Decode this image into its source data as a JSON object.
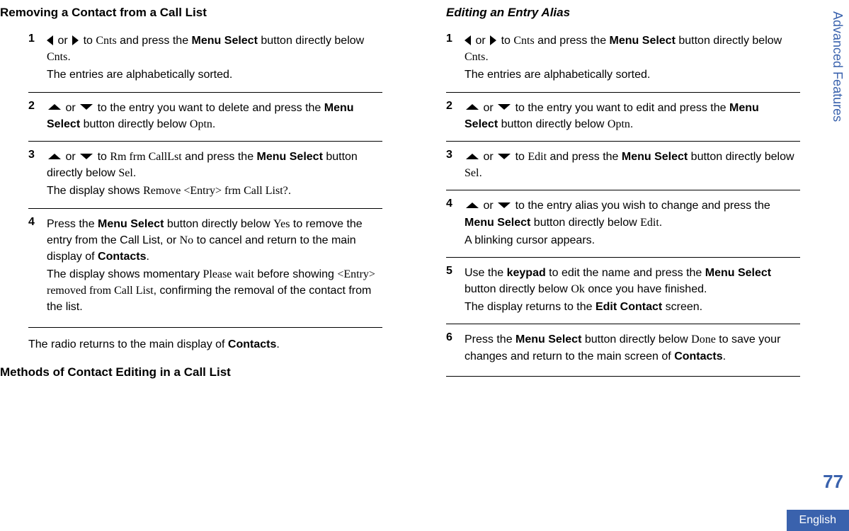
{
  "sidebar": {
    "section": "Advanced Features"
  },
  "page_number": "77",
  "language": "English",
  "left": {
    "heading": "Removing a Contact from a Call List",
    "steps": [
      {
        "num": "1",
        "pre_or": "",
        "post_or": " to ",
        "mono1": "Cnts",
        "mid1": " and press the ",
        "bold1": "Menu Select",
        "mid2": " button directly below ",
        "mono2": "Cnts",
        "tail1": ".",
        "line2": "The entries are alphabetically sorted."
      },
      {
        "num": "2",
        "pre_or": "",
        "post_or": " to the entry you want to delete and press the ",
        "bold1": "Menu Select",
        "mid1": " button directly below ",
        "mono1": "Optn",
        "tail1": "."
      },
      {
        "num": "3",
        "pre_or": "",
        "post_or": " to ",
        "mono1": "Rm frm CallLst",
        "mid1": " and press the ",
        "bold1": "Menu Select",
        "mid2": " button directly below ",
        "mono2": "Sel",
        "tail1": ".",
        "line2a": "The display shows ",
        "mono3": "Remove <Entry> frm Call List?",
        "line2b": "."
      },
      {
        "num": "4",
        "pre1": "Press the ",
        "bold1": "Menu Select",
        "mid1": " button directly below ",
        "mono1": "Yes",
        "mid2": " to remove the entry from the Call List, or ",
        "mono2": "No",
        "mid3": " to cancel and return to the main display of ",
        "bold2": "Contacts",
        "tail1": ".",
        "line2a": "The display shows momentary ",
        "mono3": "Please wait",
        "line2b": " before showing ",
        "mono4": "<Entry> removed from Call List",
        "line2c": ", confirming the removal of the contact from the list."
      }
    ],
    "after_a": "The radio returns to the main display of ",
    "after_bold": "Contacts",
    "after_b": ".",
    "subheading": "Methods of Contact Editing in a Call List"
  },
  "right": {
    "heading": "Editing an Entry Alias",
    "steps": [
      {
        "num": "1",
        "post_or": " to ",
        "mono1": "Cnts",
        "mid1": " and press the ",
        "bold1": "Menu Select",
        "mid2": " button directly below ",
        "mono2": "Cnts",
        "tail1": ".",
        "line2": "The entries are alphabetically sorted."
      },
      {
        "num": "2",
        "post_or": " to the entry you want to edit and press the ",
        "bold1": "Menu Select",
        "mid1": " button directly below ",
        "mono1": "Optn",
        "tail1": "."
      },
      {
        "num": "3",
        "post_or": " to ",
        "mono1": "Edit",
        "mid1": " and press the ",
        "bold1": "Menu Select",
        "mid2": " button directly below ",
        "mono2": "Sel",
        "tail1": "."
      },
      {
        "num": "4",
        "post_or": " to the entry alias you wish to change and press the ",
        "bold1": "Menu Select",
        "mid1": " button directly below ",
        "mono1": "Edit",
        "tail1": ".",
        "line2": "A blinking cursor appears."
      },
      {
        "num": "5",
        "pre1": "Use the ",
        "bold1": "keypad",
        "mid1": " to edit the name and press the ",
        "bold2": "Menu Select",
        "mid2": " button directly below ",
        "mono1": "Ok",
        "mid3": " once you have finished.",
        "line2a": "The display returns to the ",
        "bold3": "Edit Contact",
        "line2b": " screen."
      },
      {
        "num": "6",
        "pre1": "Press the ",
        "bold1": "Menu Select",
        "mid1": " button directly below ",
        "mono1": "Done",
        "mid2": " to save your changes and return to the main screen of ",
        "bold2": "Contacts",
        "tail1": "."
      }
    ]
  },
  "or": " or "
}
